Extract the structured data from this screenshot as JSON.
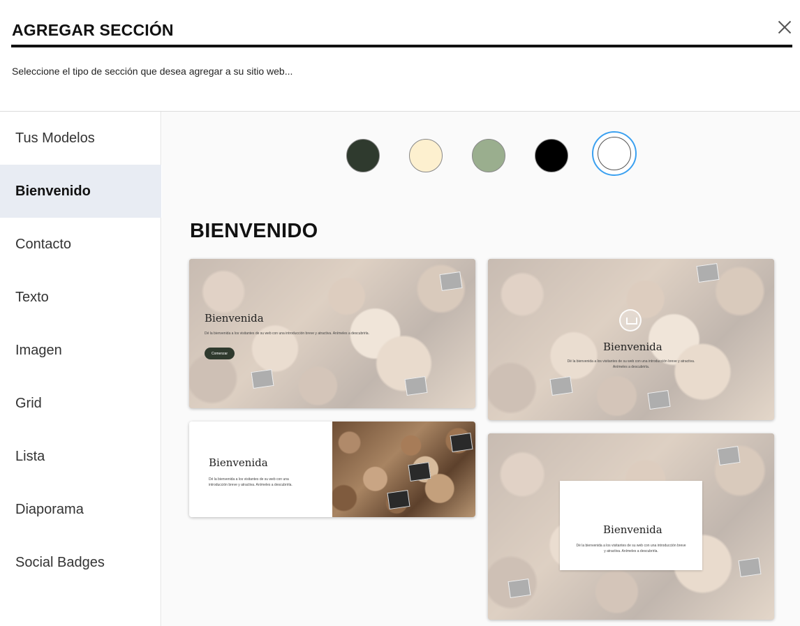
{
  "header": {
    "title": "AGREGAR SECCIÓN",
    "subtitle": "Seleccione el tipo de sección que desea agregar a su sitio web...",
    "close_icon": "close-icon"
  },
  "sidebar": {
    "items": [
      {
        "label": "Tus Modelos",
        "active": false
      },
      {
        "label": "Bienvenido",
        "active": true
      },
      {
        "label": "Contacto",
        "active": false
      },
      {
        "label": "Texto",
        "active": false
      },
      {
        "label": "Imagen",
        "active": false
      },
      {
        "label": "Grid",
        "active": false
      },
      {
        "label": "Lista",
        "active": false
      },
      {
        "label": "Diaporama",
        "active": false
      },
      {
        "label": "Social Badges",
        "active": false
      }
    ]
  },
  "swatches": [
    {
      "color": "#2f3a2e",
      "selected": false
    },
    {
      "color": "#fdf0cf",
      "selected": false
    },
    {
      "color": "#9aae8e",
      "selected": false
    },
    {
      "color": "#000000",
      "selected": false
    },
    {
      "color": "#ffffff",
      "selected": true
    }
  ],
  "section": {
    "heading": "BIENVENIDO"
  },
  "cards": [
    {
      "title": "Bienvenida",
      "text": "Dé la bienvenida a los visitantes de su web con una introducción breve y atractiva. Anímeles a descubrirla.",
      "button": "Comenzar"
    },
    {
      "title": "Bienvenida",
      "text": "Dé la bienvenida a los visitantes de su web con una introducción breve y atractiva. Anímeles a descubrirla."
    },
    {
      "title": "Bienvenida",
      "text": "Dé la bienvenida a los visitantes de su web con una introducción breve y atractiva. Anímeles a descubrirla."
    },
    {
      "title": "Bienvenida",
      "text": "Dé la bienvenida a los visitantes de su web con una introducción breve y atractiva. Anímeles a descubrirla."
    }
  ]
}
